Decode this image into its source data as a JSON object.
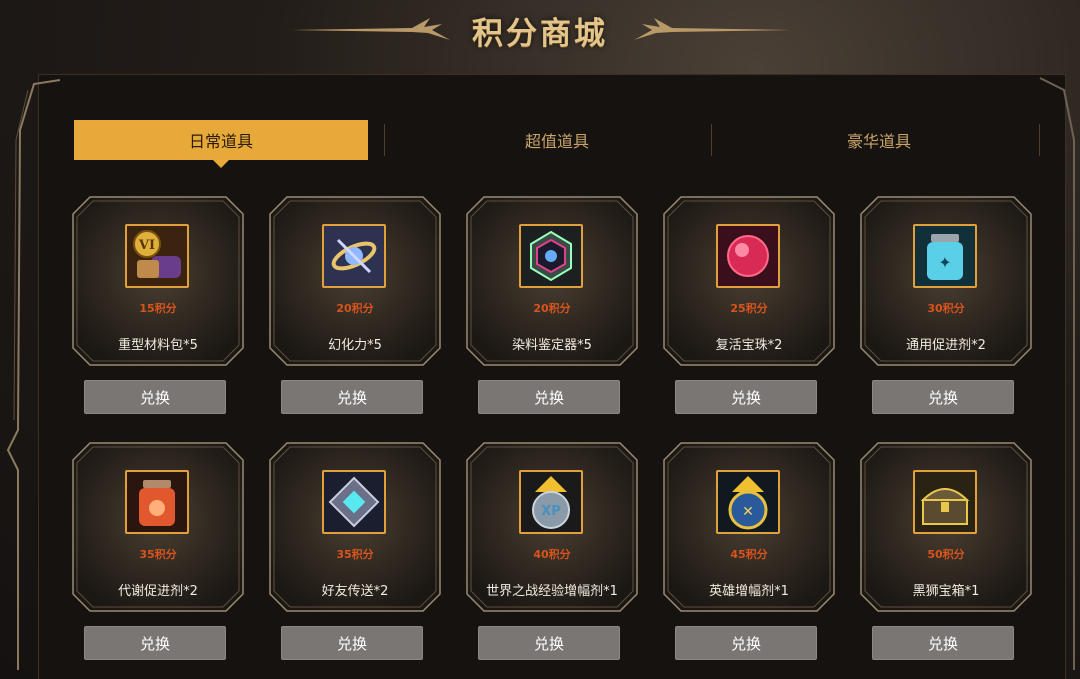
{
  "header": {
    "title": "积分商城"
  },
  "tabs": [
    {
      "label": "日常道具"
    },
    {
      "label": "超值道具"
    },
    {
      "label": "豪华道具"
    }
  ],
  "items": [
    {
      "price": "15积分",
      "name": "重型材料包*5",
      "button": "兑换",
      "icon": "material-pack-icon"
    },
    {
      "price": "20积分",
      "name": "幻化力*5",
      "button": "兑换",
      "icon": "transmog-power-icon"
    },
    {
      "price": "20积分",
      "name": "染料鉴定器*5",
      "button": "兑换",
      "icon": "dye-identifier-icon"
    },
    {
      "price": "25积分",
      "name": "复活宝珠*2",
      "button": "兑换",
      "icon": "revive-orb-icon"
    },
    {
      "price": "30积分",
      "name": "通用促进剂*2",
      "button": "兑换",
      "icon": "universal-booster-jar-icon"
    },
    {
      "price": "35积分",
      "name": "代谢促进剂*2",
      "button": "兑换",
      "icon": "metabolism-booster-jar-icon"
    },
    {
      "price": "35积分",
      "name": "好友传送*2",
      "button": "兑换",
      "icon": "friend-teleport-icon"
    },
    {
      "price": "40积分",
      "name": "世界之战经验增幅剂*1",
      "button": "兑换",
      "icon": "xp-boost-icon"
    },
    {
      "price": "45积分",
      "name": "英雄增幅剂*1",
      "button": "兑换",
      "icon": "hero-boost-icon"
    },
    {
      "price": "50积分",
      "name": "黑狮宝箱*1",
      "button": "兑换",
      "icon": "black-lion-chest-icon"
    }
  ],
  "colors": {
    "accent": "#e7a93a",
    "price": "#d9531c",
    "button": "#7a7673",
    "title": "#e3c48a"
  }
}
